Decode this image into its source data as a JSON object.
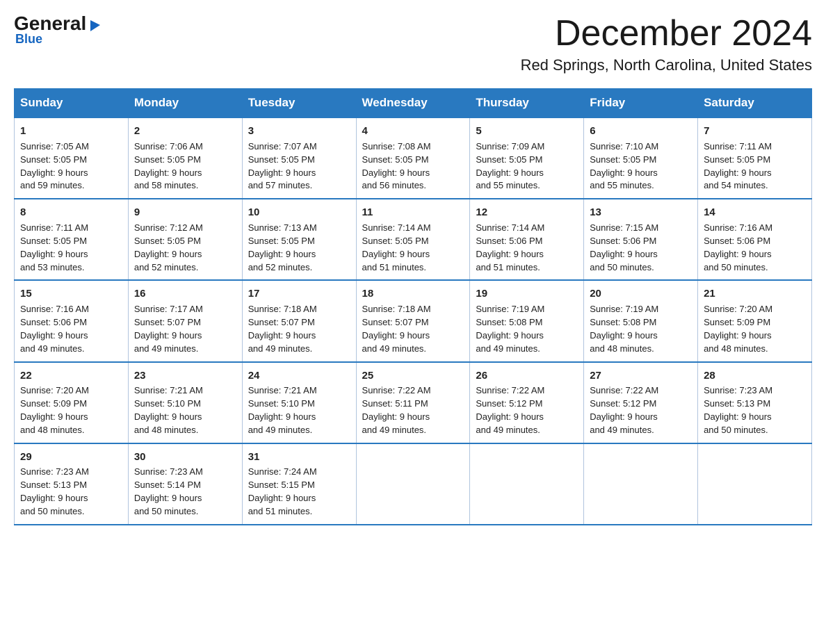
{
  "logo": {
    "general": "General",
    "arrow": "▶",
    "blue": "Blue"
  },
  "title": "December 2024",
  "location": "Red Springs, North Carolina, United States",
  "days": {
    "headers": [
      "Sunday",
      "Monday",
      "Tuesday",
      "Wednesday",
      "Thursday",
      "Friday",
      "Saturday"
    ]
  },
  "weeks": [
    {
      "cells": [
        {
          "day": "1",
          "info": "Sunrise: 7:05 AM\nSunset: 5:05 PM\nDaylight: 9 hours\nand 59 minutes."
        },
        {
          "day": "2",
          "info": "Sunrise: 7:06 AM\nSunset: 5:05 PM\nDaylight: 9 hours\nand 58 minutes."
        },
        {
          "day": "3",
          "info": "Sunrise: 7:07 AM\nSunset: 5:05 PM\nDaylight: 9 hours\nand 57 minutes."
        },
        {
          "day": "4",
          "info": "Sunrise: 7:08 AM\nSunset: 5:05 PM\nDaylight: 9 hours\nand 56 minutes."
        },
        {
          "day": "5",
          "info": "Sunrise: 7:09 AM\nSunset: 5:05 PM\nDaylight: 9 hours\nand 55 minutes."
        },
        {
          "day": "6",
          "info": "Sunrise: 7:10 AM\nSunset: 5:05 PM\nDaylight: 9 hours\nand 55 minutes."
        },
        {
          "day": "7",
          "info": "Sunrise: 7:11 AM\nSunset: 5:05 PM\nDaylight: 9 hours\nand 54 minutes."
        }
      ]
    },
    {
      "cells": [
        {
          "day": "8",
          "info": "Sunrise: 7:11 AM\nSunset: 5:05 PM\nDaylight: 9 hours\nand 53 minutes."
        },
        {
          "day": "9",
          "info": "Sunrise: 7:12 AM\nSunset: 5:05 PM\nDaylight: 9 hours\nand 52 minutes."
        },
        {
          "day": "10",
          "info": "Sunrise: 7:13 AM\nSunset: 5:05 PM\nDaylight: 9 hours\nand 52 minutes."
        },
        {
          "day": "11",
          "info": "Sunrise: 7:14 AM\nSunset: 5:05 PM\nDaylight: 9 hours\nand 51 minutes."
        },
        {
          "day": "12",
          "info": "Sunrise: 7:14 AM\nSunset: 5:06 PM\nDaylight: 9 hours\nand 51 minutes."
        },
        {
          "day": "13",
          "info": "Sunrise: 7:15 AM\nSunset: 5:06 PM\nDaylight: 9 hours\nand 50 minutes."
        },
        {
          "day": "14",
          "info": "Sunrise: 7:16 AM\nSunset: 5:06 PM\nDaylight: 9 hours\nand 50 minutes."
        }
      ]
    },
    {
      "cells": [
        {
          "day": "15",
          "info": "Sunrise: 7:16 AM\nSunset: 5:06 PM\nDaylight: 9 hours\nand 49 minutes."
        },
        {
          "day": "16",
          "info": "Sunrise: 7:17 AM\nSunset: 5:07 PM\nDaylight: 9 hours\nand 49 minutes."
        },
        {
          "day": "17",
          "info": "Sunrise: 7:18 AM\nSunset: 5:07 PM\nDaylight: 9 hours\nand 49 minutes."
        },
        {
          "day": "18",
          "info": "Sunrise: 7:18 AM\nSunset: 5:07 PM\nDaylight: 9 hours\nand 49 minutes."
        },
        {
          "day": "19",
          "info": "Sunrise: 7:19 AM\nSunset: 5:08 PM\nDaylight: 9 hours\nand 49 minutes."
        },
        {
          "day": "20",
          "info": "Sunrise: 7:19 AM\nSunset: 5:08 PM\nDaylight: 9 hours\nand 48 minutes."
        },
        {
          "day": "21",
          "info": "Sunrise: 7:20 AM\nSunset: 5:09 PM\nDaylight: 9 hours\nand 48 minutes."
        }
      ]
    },
    {
      "cells": [
        {
          "day": "22",
          "info": "Sunrise: 7:20 AM\nSunset: 5:09 PM\nDaylight: 9 hours\nand 48 minutes."
        },
        {
          "day": "23",
          "info": "Sunrise: 7:21 AM\nSunset: 5:10 PM\nDaylight: 9 hours\nand 48 minutes."
        },
        {
          "day": "24",
          "info": "Sunrise: 7:21 AM\nSunset: 5:10 PM\nDaylight: 9 hours\nand 49 minutes."
        },
        {
          "day": "25",
          "info": "Sunrise: 7:22 AM\nSunset: 5:11 PM\nDaylight: 9 hours\nand 49 minutes."
        },
        {
          "day": "26",
          "info": "Sunrise: 7:22 AM\nSunset: 5:12 PM\nDaylight: 9 hours\nand 49 minutes."
        },
        {
          "day": "27",
          "info": "Sunrise: 7:22 AM\nSunset: 5:12 PM\nDaylight: 9 hours\nand 49 minutes."
        },
        {
          "day": "28",
          "info": "Sunrise: 7:23 AM\nSunset: 5:13 PM\nDaylight: 9 hours\nand 50 minutes."
        }
      ]
    },
    {
      "cells": [
        {
          "day": "29",
          "info": "Sunrise: 7:23 AM\nSunset: 5:13 PM\nDaylight: 9 hours\nand 50 minutes."
        },
        {
          "day": "30",
          "info": "Sunrise: 7:23 AM\nSunset: 5:14 PM\nDaylight: 9 hours\nand 50 minutes."
        },
        {
          "day": "31",
          "info": "Sunrise: 7:24 AM\nSunset: 5:15 PM\nDaylight: 9 hours\nand 51 minutes."
        },
        {
          "day": "",
          "info": ""
        },
        {
          "day": "",
          "info": ""
        },
        {
          "day": "",
          "info": ""
        },
        {
          "day": "",
          "info": ""
        }
      ]
    }
  ]
}
